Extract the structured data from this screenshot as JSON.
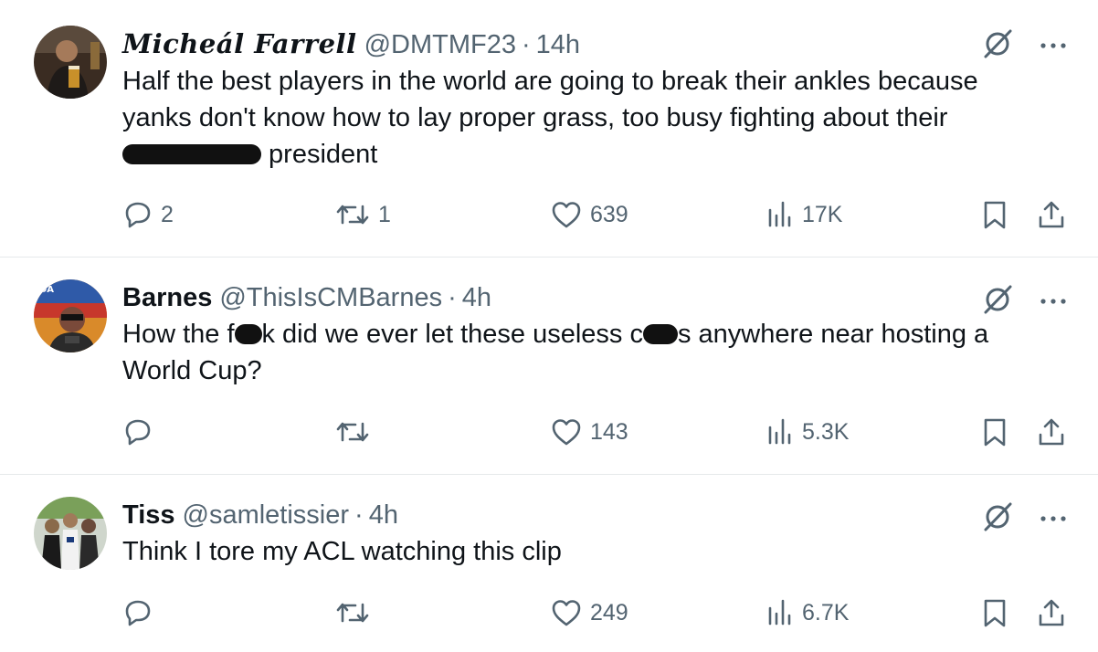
{
  "tweets": [
    {
      "name": "Micheál Farrell",
      "handle": "@DMTMF23",
      "separator": "·",
      "time": "14h",
      "text_lines": [
        "Half the best players in the world are going to break their ankles because",
        "yanks don't know how to lay proper grass, too busy fighting about their"
      ],
      "text_line3_after": " president",
      "replies": "2",
      "retweets": "1",
      "likes": "639",
      "views": "17K"
    },
    {
      "name": "Barnes",
      "handle": "@ThisIsCMBarnes",
      "separator": "·",
      "time": "4h",
      "text_part1": "How the f",
      "text_part2": "k did we ever let these useless c",
      "text_part3": "s anywhere near hosting a",
      "text_line2": "World Cup?",
      "replies": "",
      "retweets": "",
      "likes": "143",
      "views": "5.3K"
    },
    {
      "name": "Tiss",
      "handle": "@samletissier",
      "separator": "·",
      "time": "4h",
      "text_line1": "Think I tore my ACL watching this clip",
      "replies": "",
      "retweets": "",
      "likes": "249",
      "views": "6.7K"
    }
  ],
  "icons": {
    "reply": "reply-icon",
    "retweet": "retweet-icon",
    "like": "heart-icon",
    "views": "views-icon",
    "bookmark": "bookmark-icon",
    "share": "share-icon",
    "grok": "grok-icon",
    "more": "more-icon"
  },
  "colors": {
    "text": "#0f1419",
    "secondary": "#536471",
    "divider": "#e6e9eb"
  }
}
